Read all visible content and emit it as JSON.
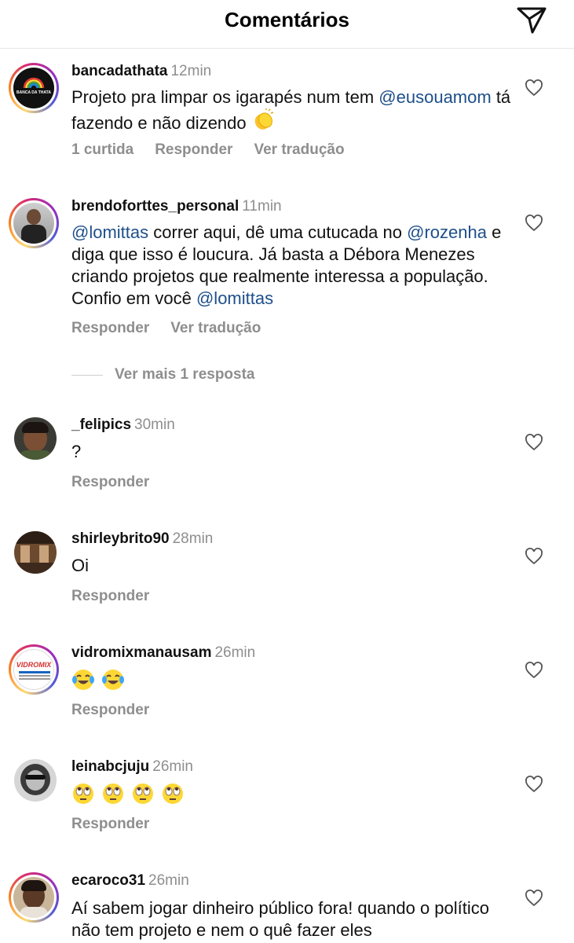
{
  "header": {
    "title": "Comentários",
    "send_icon": "send-paper-plane-icon"
  },
  "comments": [
    {
      "username": "bancadathata",
      "time": "12min",
      "text_parts": [
        "Projeto pra limpar os igarapés num tem ",
        "@eusouamom",
        " tá fazendo e não dizendo"
      ],
      "emoji": "clapping-hands",
      "likes": "1 curtida",
      "reply": "Responder",
      "translate": "Ver tradução",
      "avatar_text": "BANCA DA THATA"
    },
    {
      "username": "brendoforttes_personal",
      "time": "11min",
      "text_parts": [
        "@lomittas",
        " correr aqui, dê uma cutucada no ",
        "@rozenha",
        " e diga que isso é loucura. Já basta a Débora Menezes criando projetos que realmente interessa a população. Confio em você ",
        "@lomittas"
      ],
      "reply": "Responder",
      "translate": "Ver tradução",
      "more_replies": "Ver mais 1 resposta"
    },
    {
      "username": "_felipics",
      "time": "30min",
      "text": "?",
      "reply": "Responder"
    },
    {
      "username": "shirleybrito90",
      "time": "28min",
      "text": "Oi",
      "reply": "Responder"
    },
    {
      "username": "vidromixmanausam",
      "time": "26min",
      "emojis": [
        "tears-of-joy",
        "tears-of-joy"
      ],
      "reply": "Responder",
      "avatar_text": "VIDROMIX"
    },
    {
      "username": "leinabcjuju",
      "time": "26min",
      "emojis": [
        "rolling-eyes",
        "rolling-eyes",
        "rolling-eyes",
        "rolling-eyes"
      ],
      "reply": "Responder"
    },
    {
      "username": "ecaroco31",
      "time": "26min",
      "text": "Aí sabem jogar dinheiro público fora! quando o político não tem projeto e nem o quê fazer eles"
    }
  ],
  "colors": {
    "mention": "#1d4f8a",
    "muted": "#8e8e8e",
    "text": "#111111"
  }
}
